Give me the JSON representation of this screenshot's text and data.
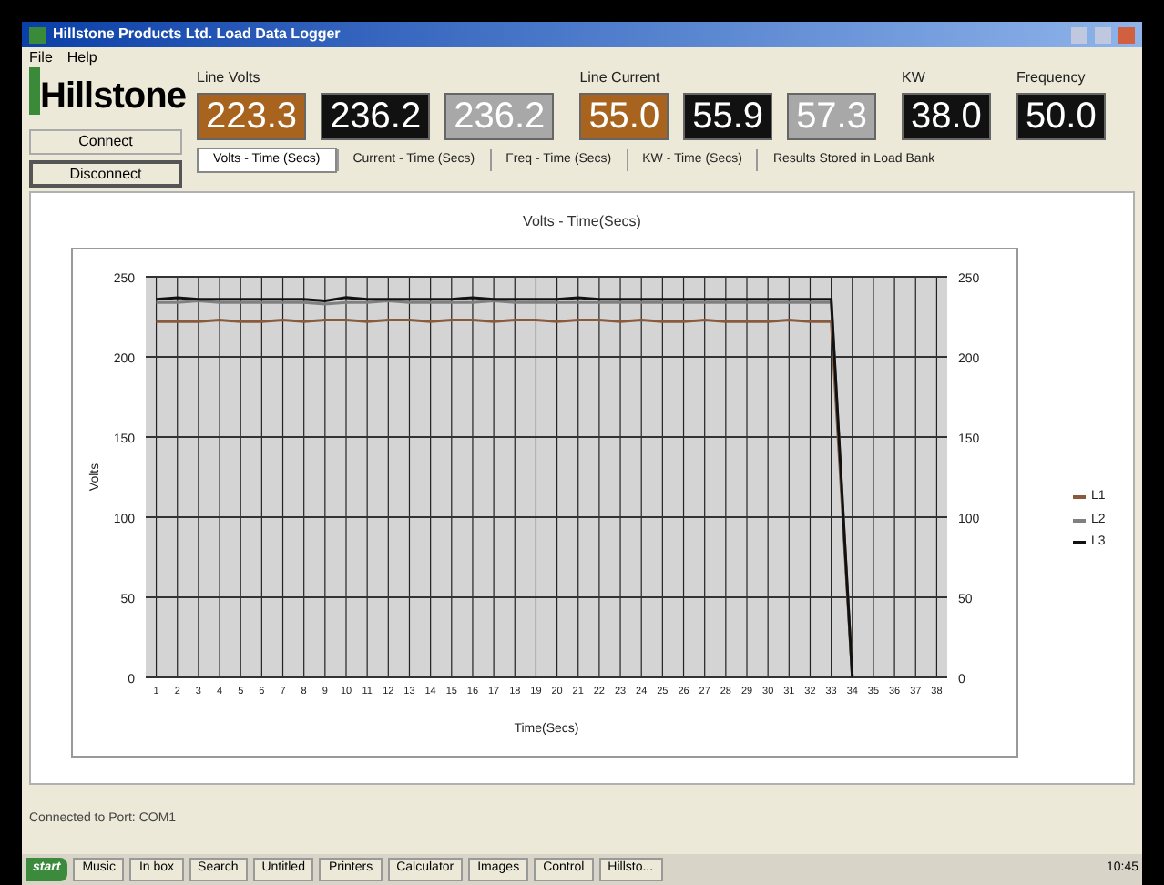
{
  "window": {
    "title": "Hillstone Products Ltd. Load Data Logger"
  },
  "menu": [
    "File",
    "Help"
  ],
  "logo": "Hillstone",
  "buttons": [
    {
      "label": "Connect",
      "selected": false
    },
    {
      "label": "Disconnect",
      "selected": true
    }
  ],
  "meter_groups": [
    {
      "label": "Line Volts",
      "readings": [
        {
          "value": "223.3",
          "color": "#a8641e"
        },
        {
          "value": "236.2",
          "color": "#111111"
        },
        {
          "value": "236.2",
          "color": "#a8a8a8"
        }
      ]
    },
    {
      "label": "Line Current",
      "readings": [
        {
          "value": "55.0",
          "color": "#a8641e"
        },
        {
          "value": "55.9",
          "color": "#111111"
        },
        {
          "value": "57.3",
          "color": "#a8a8a8"
        }
      ]
    },
    {
      "label": "KW",
      "readings": [
        {
          "value": "38.0",
          "color": "#111111"
        }
      ]
    },
    {
      "label": "Frequency",
      "readings": [
        {
          "value": "50.0",
          "color": "#111111"
        }
      ]
    }
  ],
  "tabs": [
    {
      "label": "Volts - Time (Secs)",
      "selected": true
    },
    {
      "label": "Current - Time (Secs)",
      "selected": false
    },
    {
      "label": "Freq - Time (Secs)",
      "selected": false
    },
    {
      "label": "KW - Time (Secs)",
      "selected": false
    },
    {
      "label": "Results Stored in Load Bank",
      "selected": false
    }
  ],
  "chart": {
    "right_axis_ticks": [
      "250",
      "200",
      "150",
      "100",
      "50",
      "0"
    ],
    "chart_data": {
      "type": "line",
      "title": "Volts - Time(Secs)",
      "xlabel": "Time(Secs)",
      "ylabel": "Volts",
      "x": [
        1,
        2,
        3,
        4,
        5,
        6,
        7,
        8,
        9,
        10,
        11,
        12,
        13,
        14,
        15,
        16,
        17,
        18,
        19,
        20,
        21,
        22,
        23,
        24,
        25,
        26,
        27,
        28,
        29,
        30,
        31,
        32,
        33,
        34,
        35,
        36,
        37,
        38
      ],
      "ylim": [
        0,
        250
      ],
      "yticks": [
        0,
        50,
        100,
        150,
        200,
        250
      ],
      "grid": true,
      "series": [
        {
          "name": "L1",
          "color": "#8a5a3c",
          "values": [
            222,
            222,
            222,
            223,
            222,
            222,
            223,
            222,
            223,
            223,
            222,
            223,
            223,
            222,
            223,
            223,
            222,
            223,
            223,
            222,
            223,
            223,
            222,
            223,
            222,
            222,
            223,
            222,
            222,
            222,
            223,
            222,
            222,
            0,
            null,
            null,
            null,
            null
          ]
        },
        {
          "name": "L2",
          "color": "#808080",
          "values": [
            234,
            234,
            235,
            234,
            234,
            234,
            234,
            234,
            233,
            234,
            234,
            235,
            234,
            234,
            234,
            234,
            235,
            234,
            234,
            234,
            234,
            234,
            234,
            234,
            234,
            234,
            234,
            234,
            234,
            234,
            234,
            234,
            234,
            0,
            null,
            null,
            null,
            null
          ]
        },
        {
          "name": "L3",
          "color": "#111111",
          "values": [
            236,
            237,
            236,
            236,
            236,
            236,
            236,
            236,
            235,
            237,
            236,
            236,
            236,
            236,
            236,
            237,
            236,
            236,
            236,
            236,
            237,
            236,
            236,
            236,
            236,
            236,
            236,
            236,
            236,
            236,
            236,
            236,
            236,
            0,
            null,
            null,
            null,
            null
          ]
        }
      ]
    }
  },
  "status_bar": "Connected to Port: COM1",
  "taskbar": [
    {
      "label": "start",
      "kind": "start"
    },
    {
      "label": "Music",
      "kind": "app"
    },
    {
      "label": "In box",
      "kind": "app"
    },
    {
      "label": "Search",
      "kind": "app"
    },
    {
      "label": "Untitled",
      "kind": "app"
    },
    {
      "label": "Printers",
      "kind": "app"
    },
    {
      "label": "Calculator",
      "kind": "app"
    },
    {
      "label": "Images",
      "kind": "app"
    },
    {
      "label": "Control",
      "kind": "app"
    },
    {
      "label": "Hillsto...",
      "kind": "app"
    }
  ],
  "clock": "10:45"
}
